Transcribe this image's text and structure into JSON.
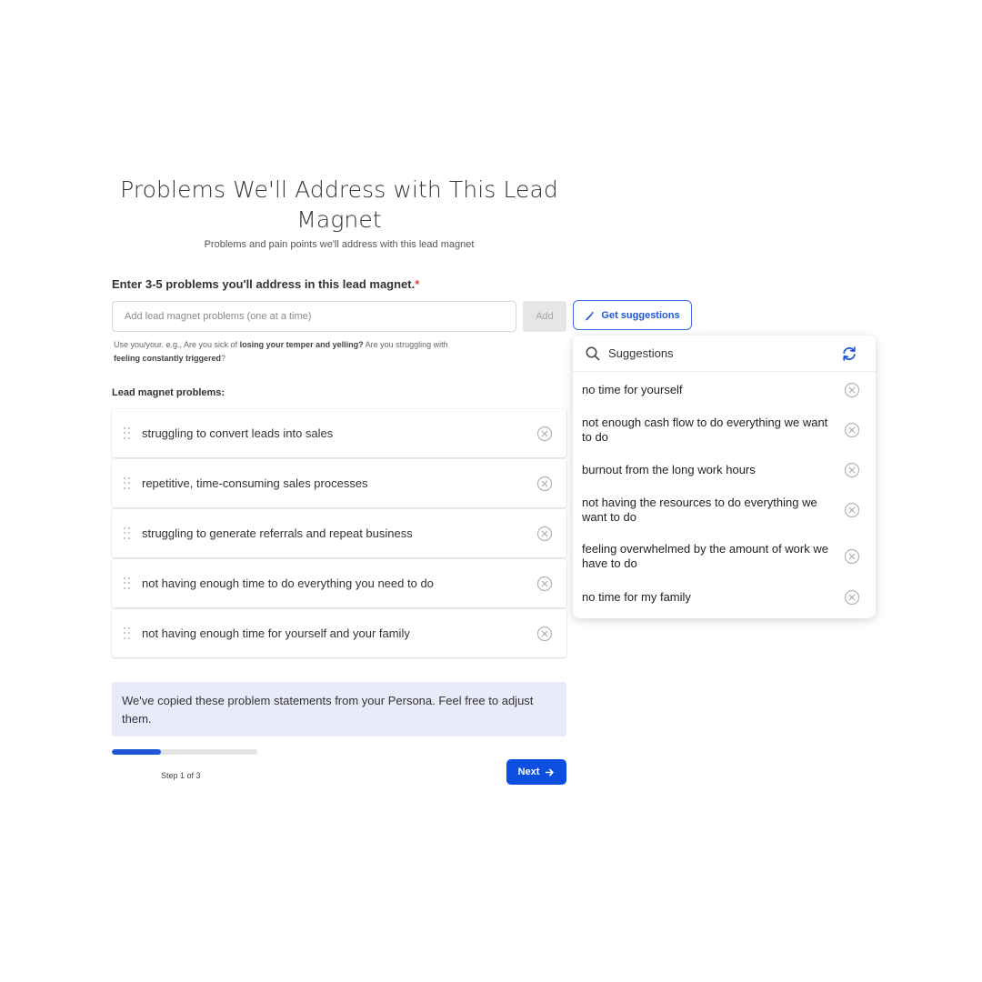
{
  "header": {
    "title": "Problems We'll Address with This Lead Magnet",
    "subtitle": "Problems and pain points we'll address with this lead magnet"
  },
  "form": {
    "label": "Enter 3-5 problems you'll address in this lead magnet.",
    "required_mark": "*",
    "input_placeholder": "Add lead magnet problems (one at a time)",
    "input_value": "",
    "add_label": "Add",
    "suggest_label": "Get suggestions",
    "helper": {
      "part1": "Use you/your. e.g., Are you sick of ",
      "bold1": "losing your temper and yelling?",
      "part2": " Are you struggling with ",
      "bold2": "feeling constantly triggered",
      "part3": "?"
    }
  },
  "problems": {
    "label": "Lead magnet problems:",
    "items": [
      "struggling to convert leads into sales",
      "repetitive, time-consuming sales processes",
      "struggling to generate referrals and repeat business",
      "not having enough time to do everything you need to do",
      "not having enough time for yourself and your family"
    ]
  },
  "note": "We've copied these problem statements from your Persona. Feel free to adjust them.",
  "progress": {
    "fraction": 0.34,
    "step_text": "Step 1 of 3"
  },
  "next_label": "Next",
  "suggestions": {
    "title": "Suggestions",
    "items": [
      "no time for yourself",
      "not enough cash flow to do everything we want to do",
      "burnout from the long work hours",
      "not having the resources to do everything we want to do",
      "feeling overwhelmed by the amount of work we have to do",
      "no time for my family"
    ]
  },
  "icons": {
    "search": "search-icon",
    "refresh": "refresh-icon",
    "remove": "close-circle-icon",
    "drag": "drag-handle-icon",
    "wand": "magic-wand-icon",
    "arrow": "arrow-right-icon"
  },
  "colors": {
    "accent": "#1f56d6",
    "next_bg": "#0b4ee0",
    "note_bg": "#e9ebfb",
    "required": "#e0443e"
  }
}
